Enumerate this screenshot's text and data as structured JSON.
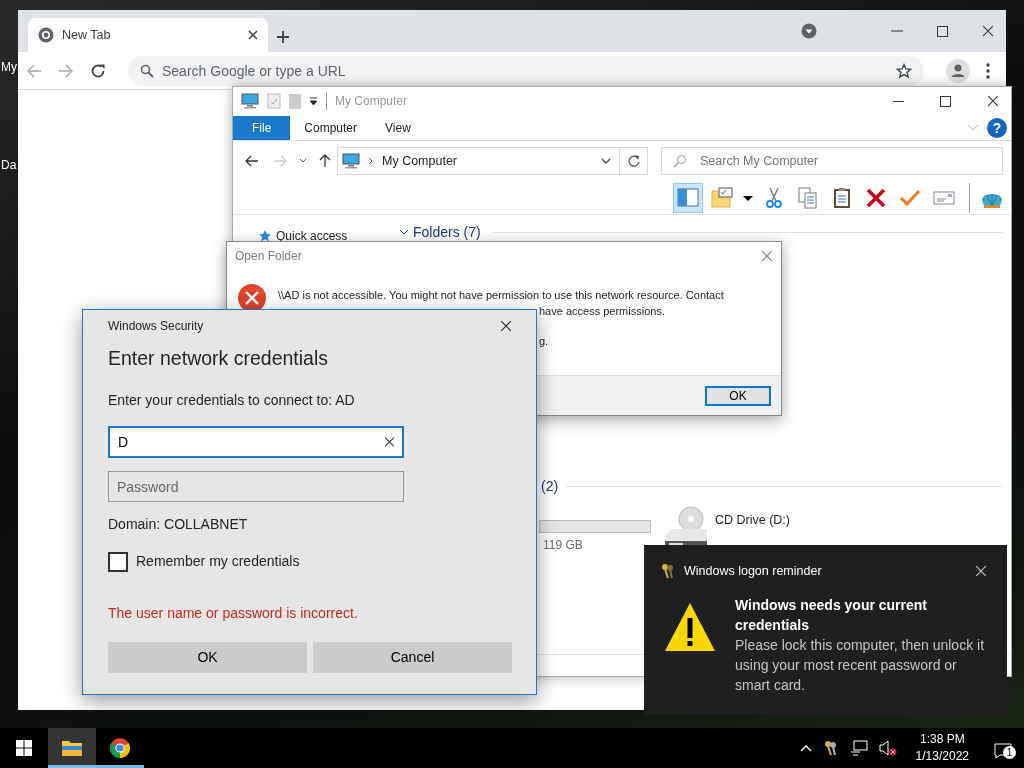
{
  "desktop": {
    "icon_labels": [
      "My",
      "Da"
    ]
  },
  "browser": {
    "tabs": [
      {
        "label": "New Tab",
        "selected": true
      }
    ],
    "omnibox": {
      "placeholder": "Search Google or type a URL"
    }
  },
  "explorer": {
    "title": "My Computer",
    "ribbon_tabs": [
      {
        "label": "File",
        "selected": true
      },
      {
        "label": "Computer",
        "selected": false
      },
      {
        "label": "View",
        "selected": false
      }
    ],
    "help": "?",
    "address": "My Computer",
    "search": {
      "placeholder": "Search My Computer"
    },
    "nav_items": [
      "Quick access"
    ],
    "folders_header": "Folders (7)",
    "devices_header": "(2)",
    "drive_partial": "119 GB",
    "cd_drive": "CD Drive (D:)"
  },
  "error_dialog": {
    "title": "Open Folder",
    "message": "\\\\AD is not accessible. You might not have permission to use this network resource. Contact",
    "message_rest": "have access permissions.",
    "message_tail": "g.",
    "button": {
      "label": "OK",
      "default": true
    }
  },
  "credentials_dialog": {
    "window_title": "Windows Security",
    "heading": "Enter network credentials",
    "prompt": "Enter your credentials to connect to: AD",
    "username": {
      "value": "D"
    },
    "password": {
      "placeholder": "Password"
    },
    "domain": "Domain: COLLABNET",
    "remember": {
      "label": "Remember my credentials",
      "checked": false
    },
    "error": "The user name or password is incorrect.",
    "buttons": [
      "OK",
      "Cancel"
    ]
  },
  "notification": {
    "app": "Windows logon reminder",
    "title": "Windows needs your current credentials",
    "body": "Please lock this computer, then unlock it using your most recent password or smart card."
  },
  "taskbar": {
    "apps": [
      {
        "kind": "explorer",
        "selected": true
      },
      {
        "kind": "chrome",
        "selected": false
      }
    ],
    "time": "1:38 PM",
    "date": "1/13/2022",
    "notification_count": "1"
  }
}
